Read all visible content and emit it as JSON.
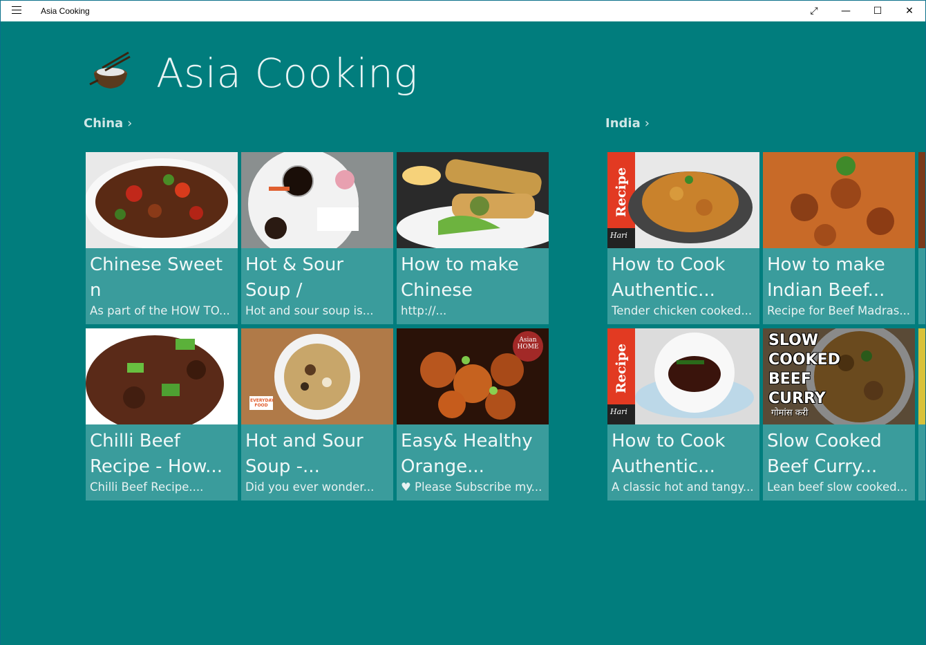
{
  "window": {
    "title": "Asia Cooking",
    "controls": {
      "fullscreen": "⤢",
      "minimize": "—",
      "maximize": "☐",
      "close": "✕"
    }
  },
  "app": {
    "title": "Asia Cooking",
    "logo_icon": "cooking-pot-icon"
  },
  "colors": {
    "background": "#017d7d",
    "tile": "#3a9c9c"
  },
  "sections": [
    {
      "name": "China",
      "tiles": [
        {
          "title": "Chinese Sweet n\nSour Pork...",
          "desc": "As part of the HOW TO..."
        },
        {
          "title": "Hot & Sour\nSoup / Chinese...",
          "desc": "Hot and sour soup is..."
        },
        {
          "title": "How to make\nChinese Spring...",
          "desc": "http://..."
        },
        {
          "title": "Chilli Beef\nRecipe - How...",
          "desc": "Chilli Beef Recipe...."
        },
        {
          "title": "Hot and Sour\nSoup -...",
          "desc": "Did you ever wonder..."
        },
        {
          "title": "Easy& Healthy\nOrange...",
          "desc": "♥ Please Subscribe my..."
        }
      ]
    },
    {
      "name": "India",
      "tiles": [
        {
          "title": "How to Cook\nAuthentic...",
          "desc": "Tender chicken cooked...",
          "badge": "Recipe",
          "badge_sub": "Hari"
        },
        {
          "title": "How to make\nIndian Beef...",
          "desc": "Recipe for Beef Madras..."
        },
        {
          "title": "How to Cook\nAuthentic...",
          "desc": "A classic hot and tangy...",
          "badge": "Recipe",
          "badge_sub": "Hari"
        },
        {
          "title": "Slow Cooked\nBeef Curry...",
          "desc": "Lean beef slow cooked...",
          "overlay": "SLOW\nCOOKED\nBEEF\nCURRY",
          "overlay_sub": "गोमांस करी"
        }
      ]
    }
  ],
  "image_labels": {
    "everyday_food": "EVERYDAY FOOD",
    "asian_home": "Asian HOME"
  }
}
